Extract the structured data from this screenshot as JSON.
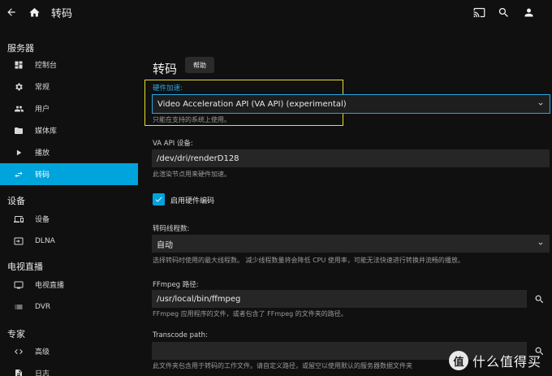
{
  "header": {
    "title": "转码"
  },
  "sidebar": {
    "sections": [
      {
        "heading": "服务器"
      },
      {
        "heading": "设备"
      },
      {
        "heading": "电视直播"
      },
      {
        "heading": "专家"
      }
    ],
    "items": [
      {
        "label": "控制台",
        "icon": "dashboard-icon"
      },
      {
        "label": "常规",
        "icon": "gear-icon"
      },
      {
        "label": "用户",
        "icon": "users-icon"
      },
      {
        "label": "媒体库",
        "icon": "folder-icon"
      },
      {
        "label": "播放",
        "icon": "play-icon"
      },
      {
        "label": "转码",
        "icon": "transcode-icon",
        "active": true
      },
      {
        "label": "设备",
        "icon": "devices-icon"
      },
      {
        "label": "DLNA",
        "icon": "dlna-icon"
      },
      {
        "label": "电视直播",
        "icon": "tv-icon"
      },
      {
        "label": "DVR",
        "icon": "list-icon"
      },
      {
        "label": "高级",
        "icon": "code-icon"
      },
      {
        "label": "日志",
        "icon": "log-icon"
      }
    ]
  },
  "main": {
    "title": "转码",
    "help_label": "帮助",
    "hw_accel": {
      "label": "硬件加速:",
      "value": "Video Acceleration API (VA API) (experimental)",
      "hint": "只能在支持的系统上使用。"
    },
    "vaapi_device": {
      "label": "VA API 设备:",
      "value": "/dev/dri/renderD128",
      "hint": "此渲染节点用来硬件加速。"
    },
    "hw_encoding": {
      "label": "启用硬件编码",
      "checked": true
    },
    "threads": {
      "label": "转码线程数:",
      "value": "自动",
      "hint": "选择转码时使用的最大线程数。 减少线程数量将会降低 CPU 使用率，可能无法快速进行转换并流畅的播放。"
    },
    "ffmpeg_path": {
      "label": "FFmpeg 路径:",
      "value": "/usr/local/bin/ffmpeg",
      "hint": "FFmpeg 应用程序的文件，或者包含了 FFmpeg 的文件夹的路径。"
    },
    "transcode_path": {
      "label": "Transcode path:",
      "value": "",
      "hint": "此文件夹包含用于转码的工作文件。请自定义路径，或留空以使用默认的服务器数据文件夹"
    }
  },
  "watermark": {
    "symbol": "值",
    "text": "什么值得买"
  },
  "colors": {
    "accent": "#00a4dc",
    "highlight_box": "#e5e02a",
    "background": "#101010"
  }
}
